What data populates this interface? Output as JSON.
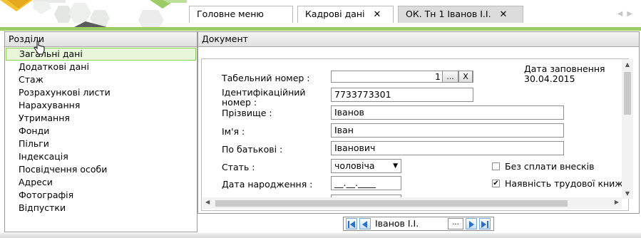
{
  "tabs": [
    {
      "label": "Головне меню",
      "closable": false,
      "active": false
    },
    {
      "label": "Кадрові дані",
      "closable": true,
      "active": false
    },
    {
      "label": "ОК. Тн 1 Іванов І.І.",
      "closable": true,
      "active": true
    }
  ],
  "tab_close_glyph": "✕",
  "tab_nav_icons": [
    "arrow-left-icon",
    "arrow-right-icon"
  ],
  "sidebar": {
    "title": "Розділи",
    "items": [
      "Загальні дані",
      "Додаткові дані",
      "Стаж",
      "Розрахункові листи",
      "Нарахування",
      "Утримання",
      "Фонди",
      "Пільги",
      "Індексація",
      "Посвідчення особи",
      "Адреси",
      "Фотографія",
      "Відпустки"
    ],
    "selected_index": 0
  },
  "document": {
    "title": "Документ",
    "fill_date_label": "Дата заповнення",
    "fill_date": "30.04.2015",
    "fields": {
      "tab_number": {
        "label": "Табельний номер :",
        "value": "1",
        "browse": "...",
        "clear": "X"
      },
      "tax_id": {
        "label_line1": "Ідентифікаційний",
        "label_line2": "номер :",
        "value": "7733773301"
      },
      "surname": {
        "label": "Прізвище :",
        "value": "Іванов"
      },
      "first_name": {
        "label": "Ім'я :",
        "value": "Іван"
      },
      "patronymic": {
        "label": "По батькові :",
        "value": "Іванович"
      },
      "gender": {
        "label": "Стать :",
        "value": "чоловіча"
      },
      "birth_date": {
        "label": "Дата народження :",
        "value": "__.__.____"
      }
    },
    "checkboxes": {
      "no_contributions": {
        "label": "Без сплати внесків",
        "checked": false
      },
      "employment_record": {
        "label": "Наявність трудової книжк",
        "checked": true
      }
    },
    "check_glyph": "✔"
  },
  "navigator": {
    "current": "Іванов І.І.",
    "more": "...",
    "icons": [
      "first-record-icon",
      "prev-record-icon",
      "next-record-icon",
      "last-record-icon"
    ]
  },
  "colors": {
    "accent_green": "#9ccc65",
    "selected_bg": "#e9f6d9",
    "active_tab": "#dcdcdc",
    "nav_blue": "#2a6fc9"
  }
}
